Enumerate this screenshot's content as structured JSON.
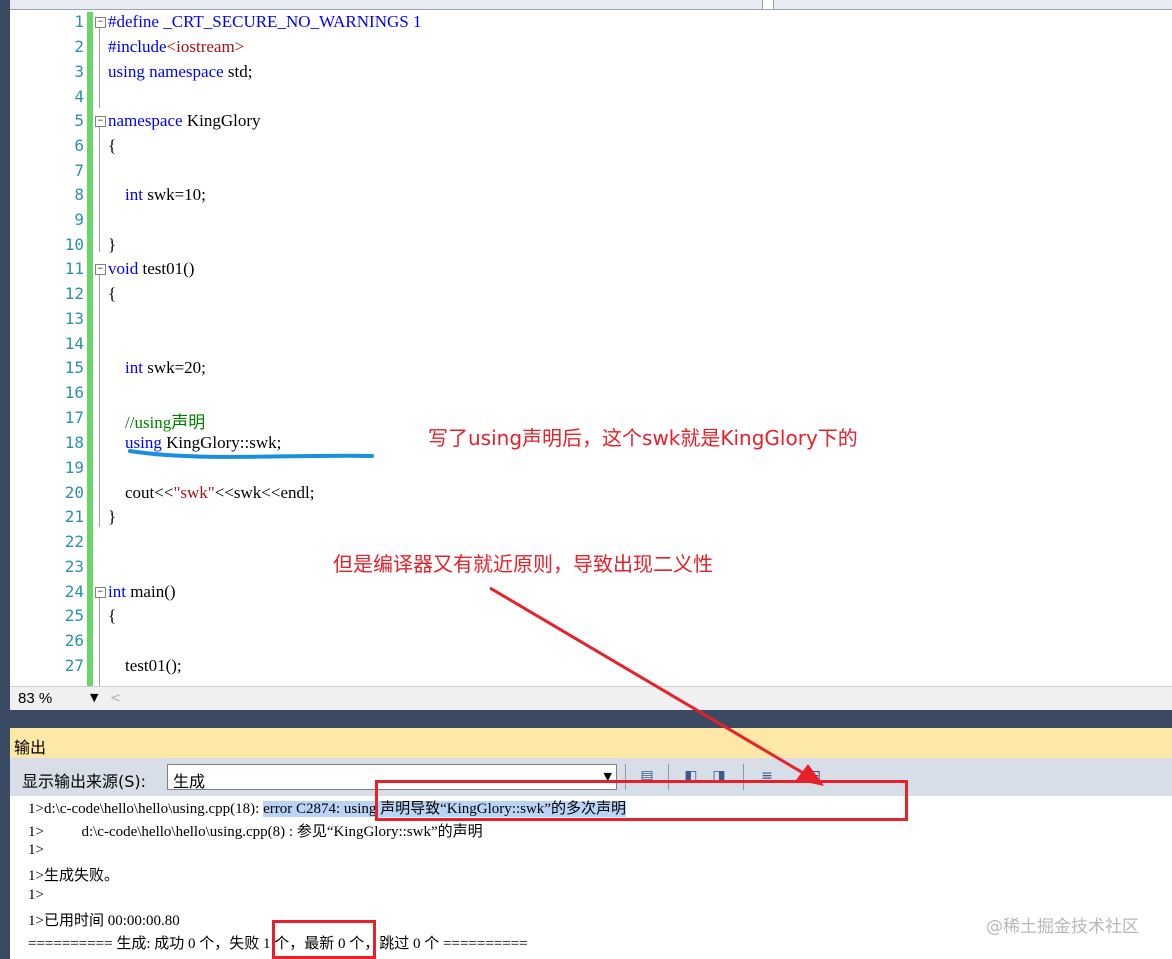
{
  "editor": {
    "lines": [
      {
        "n": "1",
        "html": "#define _CRT_SECURE_NO_WARNINGS 1"
      },
      {
        "n": "2",
        "html": "#include<iostream>"
      },
      {
        "n": "3",
        "html": "using namespace std;"
      },
      {
        "n": "4",
        "html": ""
      },
      {
        "n": "5",
        "html": "namespace KingGlory"
      },
      {
        "n": "6",
        "html": "{"
      },
      {
        "n": "7",
        "html": ""
      },
      {
        "n": "8",
        "html": "    int swk=10;"
      },
      {
        "n": "9",
        "html": ""
      },
      {
        "n": "10",
        "html": "}"
      },
      {
        "n": "11",
        "html": "void test01()"
      },
      {
        "n": "12",
        "html": "{"
      },
      {
        "n": "13",
        "html": ""
      },
      {
        "n": "14",
        "html": ""
      },
      {
        "n": "15",
        "html": "    int swk=20;"
      },
      {
        "n": "16",
        "html": ""
      },
      {
        "n": "17",
        "html": "    //using声明"
      },
      {
        "n": "18",
        "html": "    using KingGlory::swk;"
      },
      {
        "n": "19",
        "html": ""
      },
      {
        "n": "20",
        "html": "    cout<<\"swk\"<<swk<<endl;"
      },
      {
        "n": "21",
        "html": "}"
      },
      {
        "n": "22",
        "html": ""
      },
      {
        "n": "23",
        "html": ""
      },
      {
        "n": "24",
        "html": "int main()"
      },
      {
        "n": "25",
        "html": "{"
      },
      {
        "n": "26",
        "html": ""
      },
      {
        "n": "27",
        "html": "    test01();"
      }
    ]
  },
  "annotations": {
    "note1": "写了using声明后，这个swk就是KingGlory下的",
    "note2": "但是编译器又有就近原则，导致出现二义性"
  },
  "zoom": {
    "level": "83 %"
  },
  "output_panel": {
    "title": "输出",
    "source_label": "显示输出来源(S):",
    "source_value": "生成",
    "lines": [
      "1>d:\\c-code\\hello\\hello\\using.cpp(18): ",
      "error C2874: using 声明导致“KingGlory::swk”的多次声明",
      "1>          d:\\c-code\\hello\\hello\\using.cpp(8) : 参见“KingGlory::swk”的声明",
      "1>",
      "1>生成失败。",
      "1>",
      "1>已用时间 00:00:00.80",
      "========== 生成: 成功 0 个，",
      "失败 1 个，",
      "最新 0 个，跳过 0 个 =========="
    ]
  },
  "watermark": "@稀土掘金技术社区",
  "colors": {
    "keyword": "#0000ff",
    "string": "#a31515",
    "comment": "#008000",
    "line_number": "#2b91af",
    "annotation_red": "#e8202a",
    "underline_blue": "#1a8fe0"
  }
}
